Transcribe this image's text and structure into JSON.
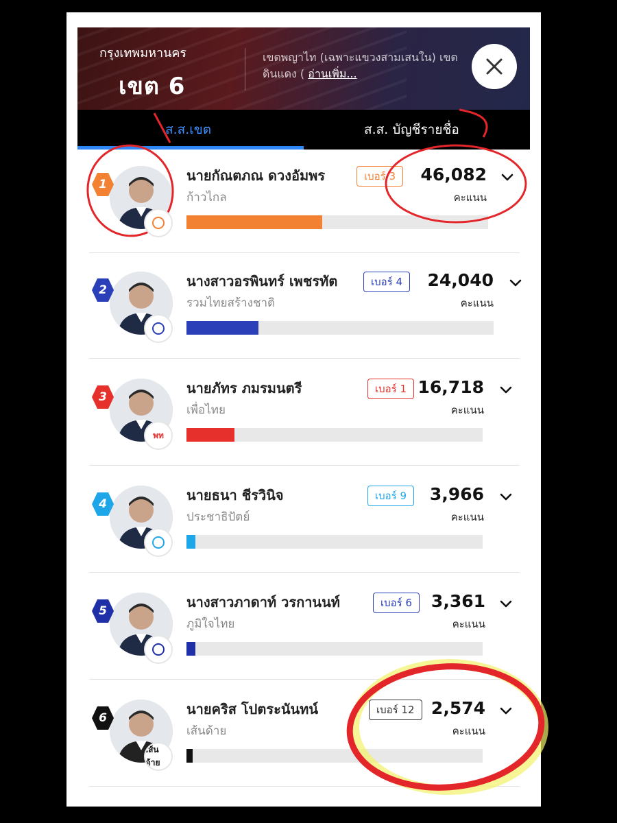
{
  "header": {
    "city": "กรุงเทพมหานคร",
    "zone": "เขต 6",
    "description": "เขตพญาไท (เฉพาะแขวงสามเสนใน) เขต",
    "description_line2": "ดินแดง (",
    "read_more": "อ่านเพิ่ม..."
  },
  "tabs": [
    {
      "label": "ส.ส.เขต",
      "active": true
    },
    {
      "label": "ส.ส. บัญชีรายชื่อ",
      "active": false
    }
  ],
  "vote_unit": "คะแนน",
  "candidates": [
    {
      "rank": "1",
      "name": "นายกัณตภณ ดวงอัมพร",
      "party": "ก้าวไกล",
      "number": "เบอร์ 3",
      "votes": "46,082",
      "vote_share": 0.45,
      "color": "#f28134",
      "party_logo": "move-forward-logo"
    },
    {
      "rank": "2",
      "name": "นางสาวอรพินทร์ เพชรทัต",
      "party": "รวมไทยสร้างชาติ",
      "number": "เบอร์ 4",
      "votes": "24,040",
      "vote_share": 0.235,
      "color": "#2b3fb9",
      "party_logo": "ruam-thai-sang-chart-logo"
    },
    {
      "rank": "3",
      "name": "นายภัทร ภมรมนตรี",
      "party": "เพื่อไทย",
      "number": "เบอร์ 1",
      "votes": "16,718",
      "vote_share": 0.163,
      "color": "#e5302c",
      "party_logo": "pheu-thai-logo",
      "party_logo_text": "พท"
    },
    {
      "rank": "4",
      "name": "นายธนา ชีรวินิจ",
      "party": "ประชาธิปัตย์",
      "number": "เบอร์ 9",
      "votes": "3,966",
      "vote_share": 0.03,
      "color": "#1ea7e8",
      "party_logo": "democrat-logo"
    },
    {
      "rank": "5",
      "name": "นางสาวภาดาท์ วรกานนท์",
      "party": "ภูมิใจไทย",
      "number": "เบอร์ 6",
      "votes": "3,361",
      "vote_share": 0.03,
      "color": "#1f2fa8",
      "party_logo": "bhumjaithai-logo"
    },
    {
      "rank": "6",
      "name": "นายคริส โปตระนันทน์",
      "party": "เส้นด้าย",
      "number": "เบอร์ 12",
      "votes": "2,574",
      "vote_share": 0.02,
      "color": "#111111",
      "party_logo": "sen-dai-logo",
      "party_logo_text": "เส้นด้าย"
    }
  ]
}
